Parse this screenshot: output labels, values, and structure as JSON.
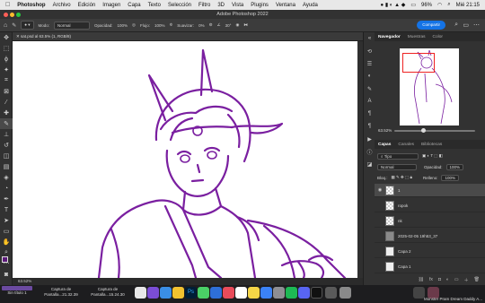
{
  "menubar": {
    "apple_icon": "apple-icon",
    "app_name": "Photoshop",
    "items": [
      "Archivo",
      "Edición",
      "Imagen",
      "Capa",
      "Texto",
      "Selección",
      "Filtro",
      "3D",
      "Vista",
      "Plugins",
      "Ventana",
      "Ayuda"
    ],
    "battery": "96%",
    "clock": "Mié 21:15"
  },
  "window": {
    "title": "Adobe Photoshop 2022"
  },
  "options_bar": {
    "mode_label": "Modo:",
    "mode_value": "Normal",
    "opacity_label": "Opacidad:",
    "opacity_value": "100%",
    "flow_label": "Flujo:",
    "flow_value": "100%",
    "smoothing_label": "Suavizar:",
    "smoothing_value": "0%",
    "angle_value": "30°",
    "share_label": "Compartir"
  },
  "document": {
    "tab_label": "sat.psd al 63.5% (1, RGB/8)",
    "zoom_status": "63.52%"
  },
  "navigator": {
    "tabs": [
      "Navegador",
      "Muestras",
      "Color"
    ],
    "active_tab": 0,
    "zoom": "63.52%"
  },
  "layers_panel": {
    "tabs": [
      "Capas",
      "Canales",
      "Bibliotecas"
    ],
    "filter_value": "Tipo",
    "blend_mode": "Normal",
    "opacity_label": "Opacidad:",
    "opacity_value": "100%",
    "lock_label": "Bloq.:",
    "fill_label": "Relleno:",
    "fill_value": "100%",
    "layers": [
      {
        "name": "1",
        "active": true
      },
      {
        "name": "ropok",
        "active": false
      },
      {
        "name": "nk",
        "active": false
      },
      {
        "name": "2025-02-05 19h53_37",
        "active": false
      },
      {
        "name": "Capa 2",
        "active": false
      },
      {
        "name": "Capa 1",
        "active": false
      }
    ]
  },
  "dock": {
    "windows": [
      {
        "label": "Sin título 1"
      },
      {
        "label_line1": "Captura de",
        "label_line2": "Pantalla...21.32.39"
      },
      {
        "label_line1": "Captura de",
        "label_line2": "Pantalla...15.24.30"
      }
    ],
    "right_label": "Monster Pram Dream Daddy A..."
  },
  "colors": {
    "accent": "#1473e6",
    "line_art": "#7a1fa0",
    "nav_frame": "#e22222",
    "foreground_swatch": "#5b1a7a"
  }
}
